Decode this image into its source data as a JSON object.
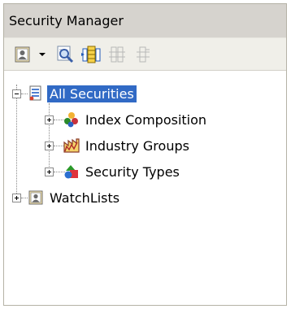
{
  "panel": {
    "title": "Security Manager"
  },
  "toolbar": {
    "buttons": [
      "user-card-icon",
      "dropdown-arrow-icon",
      "magnify-icon",
      "insert-column-icon",
      "column-disabled-icon",
      "column-disabled-icon"
    ]
  },
  "tree": {
    "root": {
      "label": "All Securities",
      "expanded": true,
      "selected": true
    },
    "children": [
      {
        "label": "Index Composition",
        "icon": "balls-icon"
      },
      {
        "label": "Industry Groups",
        "icon": "factory-icon"
      },
      {
        "label": "Security Types",
        "icon": "shapes-icon"
      }
    ],
    "watchlists": {
      "label": "WatchLists"
    }
  },
  "colors": {
    "selection": "#316ac5",
    "titlebar": "#d6d3ce",
    "toolbar": "#f0efe9"
  }
}
